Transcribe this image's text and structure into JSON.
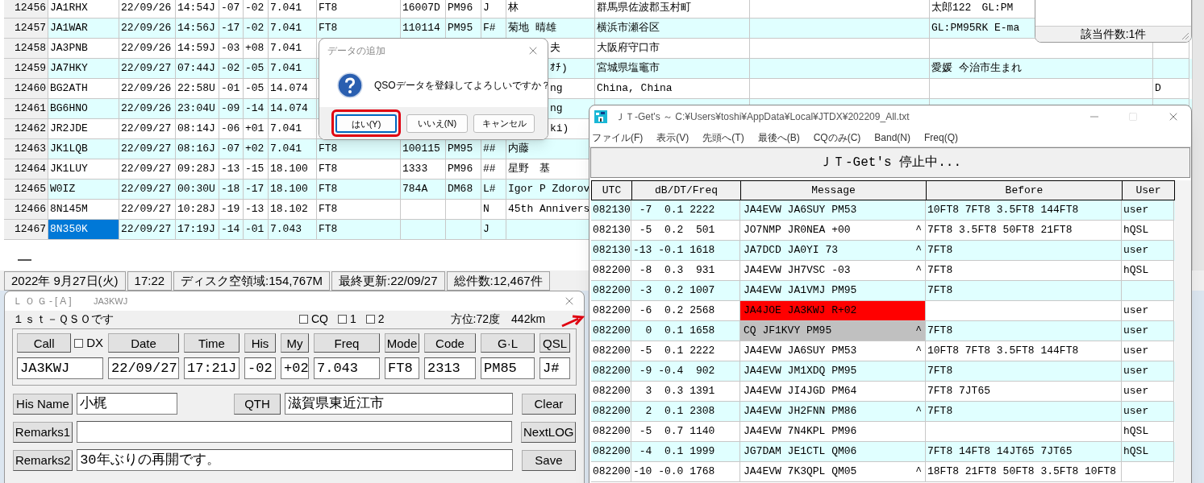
{
  "main_window": {
    "rows": [
      {
        "no": "12456",
        "call": "JA1RHX",
        "date": "22/09/26",
        "time": "14:54J",
        "his": "-07",
        "my": "-02",
        "freq": "7.041",
        "mode": "FT8",
        "code": "16007D",
        "gl": "PM96",
        "qsl": "J",
        "name": "林",
        "qth": "群馬県佐波郡玉村町",
        "remarks": "太郎122　GL:PM",
        "selected": false,
        "name_cut": false
      },
      {
        "no": "12457",
        "call": "JA1WAR",
        "date": "22/09/26",
        "time": "14:56J",
        "his": "-17",
        "my": "-02",
        "freq": "7.041",
        "mode": "FT8",
        "code": "110114",
        "gl": "PM95",
        "qsl": "F#",
        "name": "菊地 晴雄",
        "qth": "横浜市瀬谷区",
        "remarks": "GL:PM95RK E-ma",
        "selected": false,
        "name_cut": false
      },
      {
        "no": "12458",
        "call": "JA3PNB",
        "date": "22/09/26",
        "time": "14:59J",
        "his": "-03",
        "my": "+08",
        "freq": "7.041",
        "name": "夫",
        "qth": "大阪府守口市",
        "selected": false,
        "name_cut": true
      },
      {
        "no": "12459",
        "call": "JA7HKY",
        "date": "22/09/27",
        "time": "07:44J",
        "his": "-02",
        "my": "-05",
        "freq": "7.041",
        "name": "ｵﾁ)",
        "qth": "宮城県塩竈市",
        "remarks": "愛媛 今治市生まれ",
        "selected": false,
        "name_cut": true
      },
      {
        "no": "12460",
        "call": "BG2ATH",
        "date": "22/09/26",
        "time": "22:58U",
        "his": "-01",
        "my": "-05",
        "freq": "14.074",
        "name": "ng",
        "qth": "China, China",
        "column_16": "D",
        "selected": false,
        "name_cut": true
      },
      {
        "no": "12461",
        "call": "BG6HNO",
        "date": "22/09/26",
        "time": "23:04U",
        "his": "-09",
        "my": "-14",
        "freq": "14.074",
        "name": "ng",
        "selected": false,
        "name_cut": true
      },
      {
        "no": "12462",
        "call": "JR2JDE",
        "date": "22/09/27",
        "time": "08:14J",
        "his": "-06",
        "my": "+01",
        "freq": "7.041",
        "name": "ki)",
        "selected": false,
        "name_cut": true
      },
      {
        "no": "12463",
        "call": "JK1LQB",
        "date": "22/09/27",
        "time": "08:16J",
        "his": "-07",
        "my": "+02",
        "freq": "7.041",
        "mode": "FT8",
        "code": "100115",
        "gl": "PM95",
        "qsl": "##",
        "name": "内藤",
        "selected": false,
        "name_cut": false
      },
      {
        "no": "12464",
        "call": "JK1LUY",
        "date": "22/09/27",
        "time": "09:28J",
        "his": "-13",
        "my": "-15",
        "freq": "18.100",
        "mode": "FT8",
        "code": "1333",
        "gl": "PM96",
        "qsl": "##",
        "name": "星野　基",
        "selected": false,
        "name_cut": false
      },
      {
        "no": "12465",
        "call": "W0IZ",
        "date": "22/09/27",
        "time": "00:30U",
        "his": "-18",
        "my": "-17",
        "freq": "18.100",
        "mode": "FT8",
        "code": "784A",
        "gl": "DM68",
        "qsl": "L#",
        "name": "Igor P Zdorov",
        "selected": false,
        "name_cut": false
      },
      {
        "no": "12466",
        "call": "8N145M",
        "date": "22/09/27",
        "time": "10:28J",
        "his": "-19",
        "my": "-13",
        "freq": "18.102",
        "mode": "FT8",
        "qsl": "N",
        "name": "45th Annivers",
        "selected": false,
        "name_cut": false
      },
      {
        "no": "12467",
        "call": "8N350K",
        "date": "22/09/27",
        "time": "17:19J",
        "his": "-14",
        "my": "-01",
        "freq": "7.043",
        "mode": "FT8",
        "qsl": "J",
        "selected": true,
        "name_cut": false
      }
    ],
    "status_bar": [
      "2022年 9月27日(火)",
      "17:22",
      "ディスク空領域:154,767M",
      "最終更新:22/09/27",
      "総件数:12,467件"
    ]
  },
  "search_window": {
    "status": "該当件数:1件"
  },
  "dialog": {
    "title": "データの追加",
    "message": "QSOデータを登録してよろしいですか？",
    "buttons": [
      {
        "label": "はい(Y)",
        "selected": true,
        "annotated": true
      },
      {
        "label": "いいえ(N)",
        "selected": false,
        "annotated": false
      },
      {
        "label": "キャンセル",
        "selected": false,
        "annotated": false
      }
    ]
  },
  "log_window": {
    "title": "ＬＯＧ-[A]",
    "callsign": "JA3KWJ",
    "notice": "１ｓｔ－ＱＳＯです",
    "checkboxes": [
      {
        "label": "CQ",
        "checked": false
      },
      {
        "label": "1",
        "checked": false
      },
      {
        "label": "2",
        "checked": false
      }
    ],
    "bearing": "方位:72度　442km",
    "dx": {
      "label": "DX",
      "checked": false
    },
    "fields": [
      {
        "button": "Call",
        "value": "JA3KWJ"
      },
      {
        "button": "Date",
        "value": "22/09/27"
      },
      {
        "button": "Time",
        "value": "17:21J"
      },
      {
        "button": "His",
        "value": "-02"
      },
      {
        "button": "My",
        "value": "+02"
      },
      {
        "button": "Freq",
        "value": "7.043"
      },
      {
        "button": "Mode",
        "value": "FT8"
      },
      {
        "button": "Code",
        "value": "2313"
      },
      {
        "button": "G·L",
        "value": "PM85"
      },
      {
        "button": "QSL",
        "value": "J#"
      }
    ],
    "lines": [
      {
        "button": "His Name",
        "value": "小梶",
        "button2": "QTH",
        "value2": "滋賀県東近江市",
        "action": "Clear"
      },
      {
        "button": "Remarks1",
        "action": "NextLOG"
      },
      {
        "button": "Remarks2",
        "value": "30年ぶりの再開です。",
        "action": "Save"
      }
    ]
  },
  "jt_window": {
    "title": "ＪＴ-Get's ～ C:¥Users¥toshi¥AppData¥Local¥JTDX¥202209_All.txt",
    "menu": [
      "ファイル(F)",
      "表示(V)",
      "先頭へ(T)",
      "最後へ(B)",
      "CQのみ(C)",
      "Band(N)",
      "Freq(Q)"
    ],
    "status": "ＪＴ-Get's 停止中...",
    "columns": [
      "UTC",
      "dB/DT/Freq",
      "Message",
      "Before",
      "User"
    ],
    "rows": [
      {
        "utc": "082130",
        "signal": " -7  0.1 2222",
        "message": "JA4EVW JA6SUY PM53",
        "before": "10FT8 7FT8 3.5FT8 144FT8",
        "user": "user"
      },
      {
        "utc": "082130",
        "signal": " -5  0.2  501",
        "message": "JO7NMP JR0NEA +00",
        "mark": "^",
        "before": "7FT8 3.5FT8 50FT8 21FT8",
        "user": "hQSL"
      },
      {
        "utc": "082130",
        "signal": "-13 -0.1 1618",
        "message": "JA7DCD JA0YI 73",
        "mark": "^",
        "before": "7FT8",
        "user": "user"
      },
      {
        "utc": "082200",
        "signal": " -8  0.3  931",
        "message": "JA4EVW JH7VSC -03",
        "mark": "^",
        "before": "7FT8",
        "user": "hQSL"
      },
      {
        "utc": "082200",
        "signal": " -3  0.2 1007",
        "message": "JA4EVW JA1VMJ PM95",
        "before": "7FT8"
      },
      {
        "utc": "082200",
        "signal": " -6  0.2 2568",
        "message": "JA4JOE JA3KWJ R+02",
        "color": "#ff0000",
        "user": "user"
      },
      {
        "utc": "082200",
        "signal": "  0  0.1 1658",
        "message": "CQ JF1KVY PM95",
        "mark": "^",
        "color": "#c0c0c0",
        "before": "7FT8",
        "user": "user"
      },
      {
        "utc": "082200",
        "signal": " -5  0.1 2222",
        "message": "JA4EVW JA6SUY PM53",
        "mark": "^",
        "before": "10FT8 7FT8 3.5FT8 144FT8",
        "user": "user"
      },
      {
        "utc": "082200",
        "signal": " -9 -0.4  902",
        "message": "JA4EVW JM1XDQ PM95",
        "before": "7FT8",
        "user": "user"
      },
      {
        "utc": "082200",
        "signal": "  3  0.3 1391",
        "message": "JA4EVW JI4JGD PM64",
        "before": "7FT8 7JT65",
        "user": "user"
      },
      {
        "utc": "082200",
        "signal": "  2  0.1 2308",
        "message": "JA4EVW JH2FNN PM86",
        "mark": "^",
        "before": "7FT8",
        "user": "user"
      },
      {
        "utc": "082200",
        "signal": " -5  0.7 1140",
        "message": "JA4EVW 7N4KPL PM96",
        "user": "hQSL"
      },
      {
        "utc": "082200",
        "signal": " -4  0.1 1999",
        "message": "JG7DAM JE1CTL QM06",
        "before": "7FT8 14FT8 14JT65 7JT65",
        "user": "hQSL"
      },
      {
        "utc": "082200",
        "signal": "-10 -0.0 1768",
        "message": "JA4EVW 7K3QPL QM05",
        "mark": "^",
        "before": "18FT8 21FT8 50FT8 3.5FT8 10FT8"
      }
    ]
  }
}
